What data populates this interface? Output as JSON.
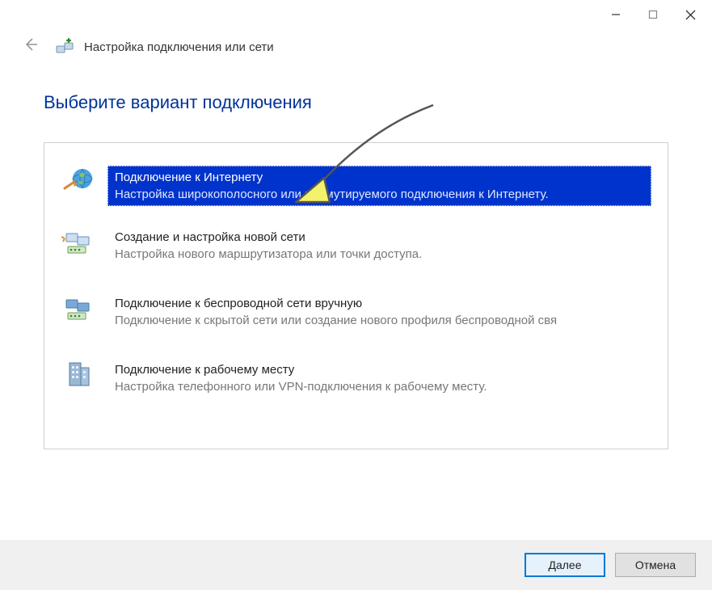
{
  "header": {
    "title": "Настройка подключения или сети"
  },
  "main": {
    "heading": "Выберите вариант подключения"
  },
  "options": [
    {
      "title": "Подключение к Интернету",
      "sub": "Настройка широкополосного или коммутируемого подключения к Интернету."
    },
    {
      "title": "Создание и настройка новой сети",
      "sub": "Настройка нового маршрутизатора или точки доступа."
    },
    {
      "title": "Подключение к беспроводной сети вручную",
      "sub": "Подключение к скрытой сети или создание нового профиля беспроводной свя"
    },
    {
      "title": "Подключение к рабочему месту",
      "sub": "Настройка телефонного или VPN-подключения к рабочему месту."
    }
  ],
  "footer": {
    "next": "Далее",
    "cancel": "Отмена"
  }
}
